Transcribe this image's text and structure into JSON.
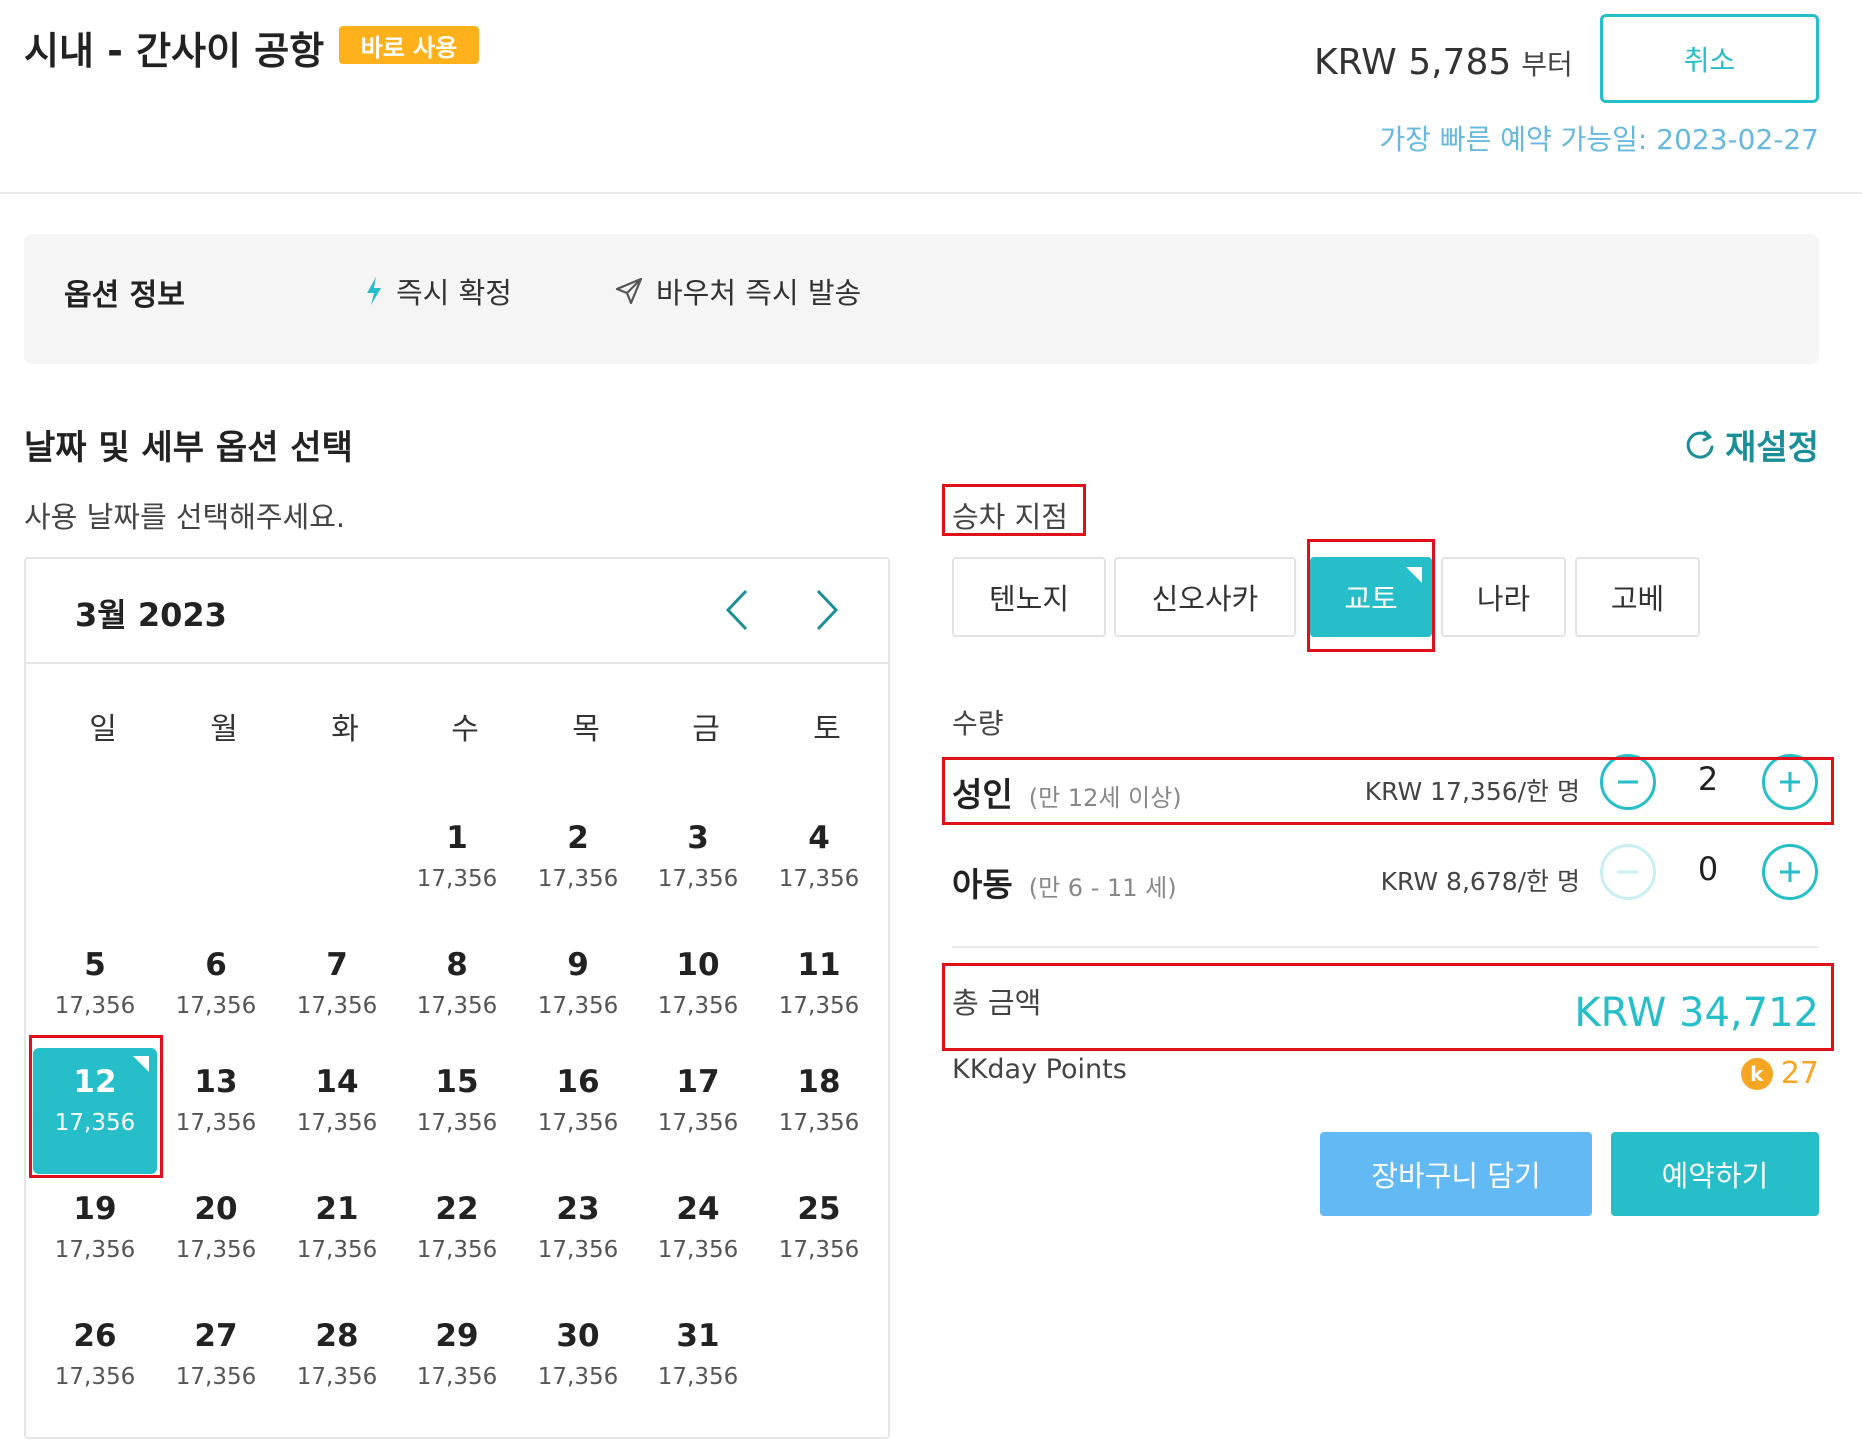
{
  "header": {
    "title": "시내 - 간사이 공항",
    "badge": "바로 사용",
    "price_from": "KRW 5,785",
    "price_suffix": "부터",
    "cancel_label": "취소",
    "earliest_date": "가장 빠른 예약 가능일: 2023-02-27"
  },
  "option_info": {
    "title": "옵션 정보",
    "instant_confirm": "즉시 확정",
    "voucher": "바우처 즉시 발송"
  },
  "date_section": {
    "title": "날짜 및 세부 옵션 선택",
    "reset_label": "재설정",
    "hint": "사용 날짜를 선택해주세요."
  },
  "calendar": {
    "month_title": "3월 2023",
    "weekdays": [
      "일",
      "월",
      "화",
      "수",
      "목",
      "금",
      "토"
    ],
    "first_weekday_index": 3,
    "days": [
      {
        "day": "1",
        "price": "17,356"
      },
      {
        "day": "2",
        "price": "17,356"
      },
      {
        "day": "3",
        "price": "17,356"
      },
      {
        "day": "4",
        "price": "17,356"
      },
      {
        "day": "5",
        "price": "17,356"
      },
      {
        "day": "6",
        "price": "17,356"
      },
      {
        "day": "7",
        "price": "17,356"
      },
      {
        "day": "8",
        "price": "17,356"
      },
      {
        "day": "9",
        "price": "17,356"
      },
      {
        "day": "10",
        "price": "17,356"
      },
      {
        "day": "11",
        "price": "17,356"
      },
      {
        "day": "12",
        "price": "17,356"
      },
      {
        "day": "13",
        "price": "17,356"
      },
      {
        "day": "14",
        "price": "17,356"
      },
      {
        "day": "15",
        "price": "17,356"
      },
      {
        "day": "16",
        "price": "17,356"
      },
      {
        "day": "17",
        "price": "17,356"
      },
      {
        "day": "18",
        "price": "17,356"
      },
      {
        "day": "19",
        "price": "17,356"
      },
      {
        "day": "20",
        "price": "17,356"
      },
      {
        "day": "21",
        "price": "17,356"
      },
      {
        "day": "22",
        "price": "17,356"
      },
      {
        "day": "23",
        "price": "17,356"
      },
      {
        "day": "24",
        "price": "17,356"
      },
      {
        "day": "25",
        "price": "17,356"
      },
      {
        "day": "26",
        "price": "17,356"
      },
      {
        "day": "27",
        "price": "17,356"
      },
      {
        "day": "28",
        "price": "17,356"
      },
      {
        "day": "29",
        "price": "17,356"
      },
      {
        "day": "30",
        "price": "17,356"
      },
      {
        "day": "31",
        "price": "17,356"
      }
    ],
    "selected_day": "12"
  },
  "pickup": {
    "label": "승차 지점",
    "options": [
      "텐노지",
      "신오사카",
      "교토",
      "나라",
      "고베"
    ],
    "selected": "교토"
  },
  "quantity": {
    "label": "수량",
    "adult": {
      "name": "성인",
      "sub": "(만 12세 이상)",
      "price": "KRW 17,356/한 명",
      "value": "2"
    },
    "child": {
      "name": "아동",
      "sub": "(만 6 - 11 세)",
      "price": "KRW 8,678/한 명",
      "value": "0"
    }
  },
  "total": {
    "label": "총 금액",
    "value": "KRW 34,712"
  },
  "points": {
    "label": "KKday Points",
    "coin": "k",
    "value": "27"
  },
  "actions": {
    "cart_label": "장바구니 담기",
    "book_label": "예약하기"
  },
  "colors": {
    "accent": "#26bec9",
    "badge": "#ffb11b",
    "cart": "#62b9f3",
    "highlight_box": "#e0101a"
  }
}
